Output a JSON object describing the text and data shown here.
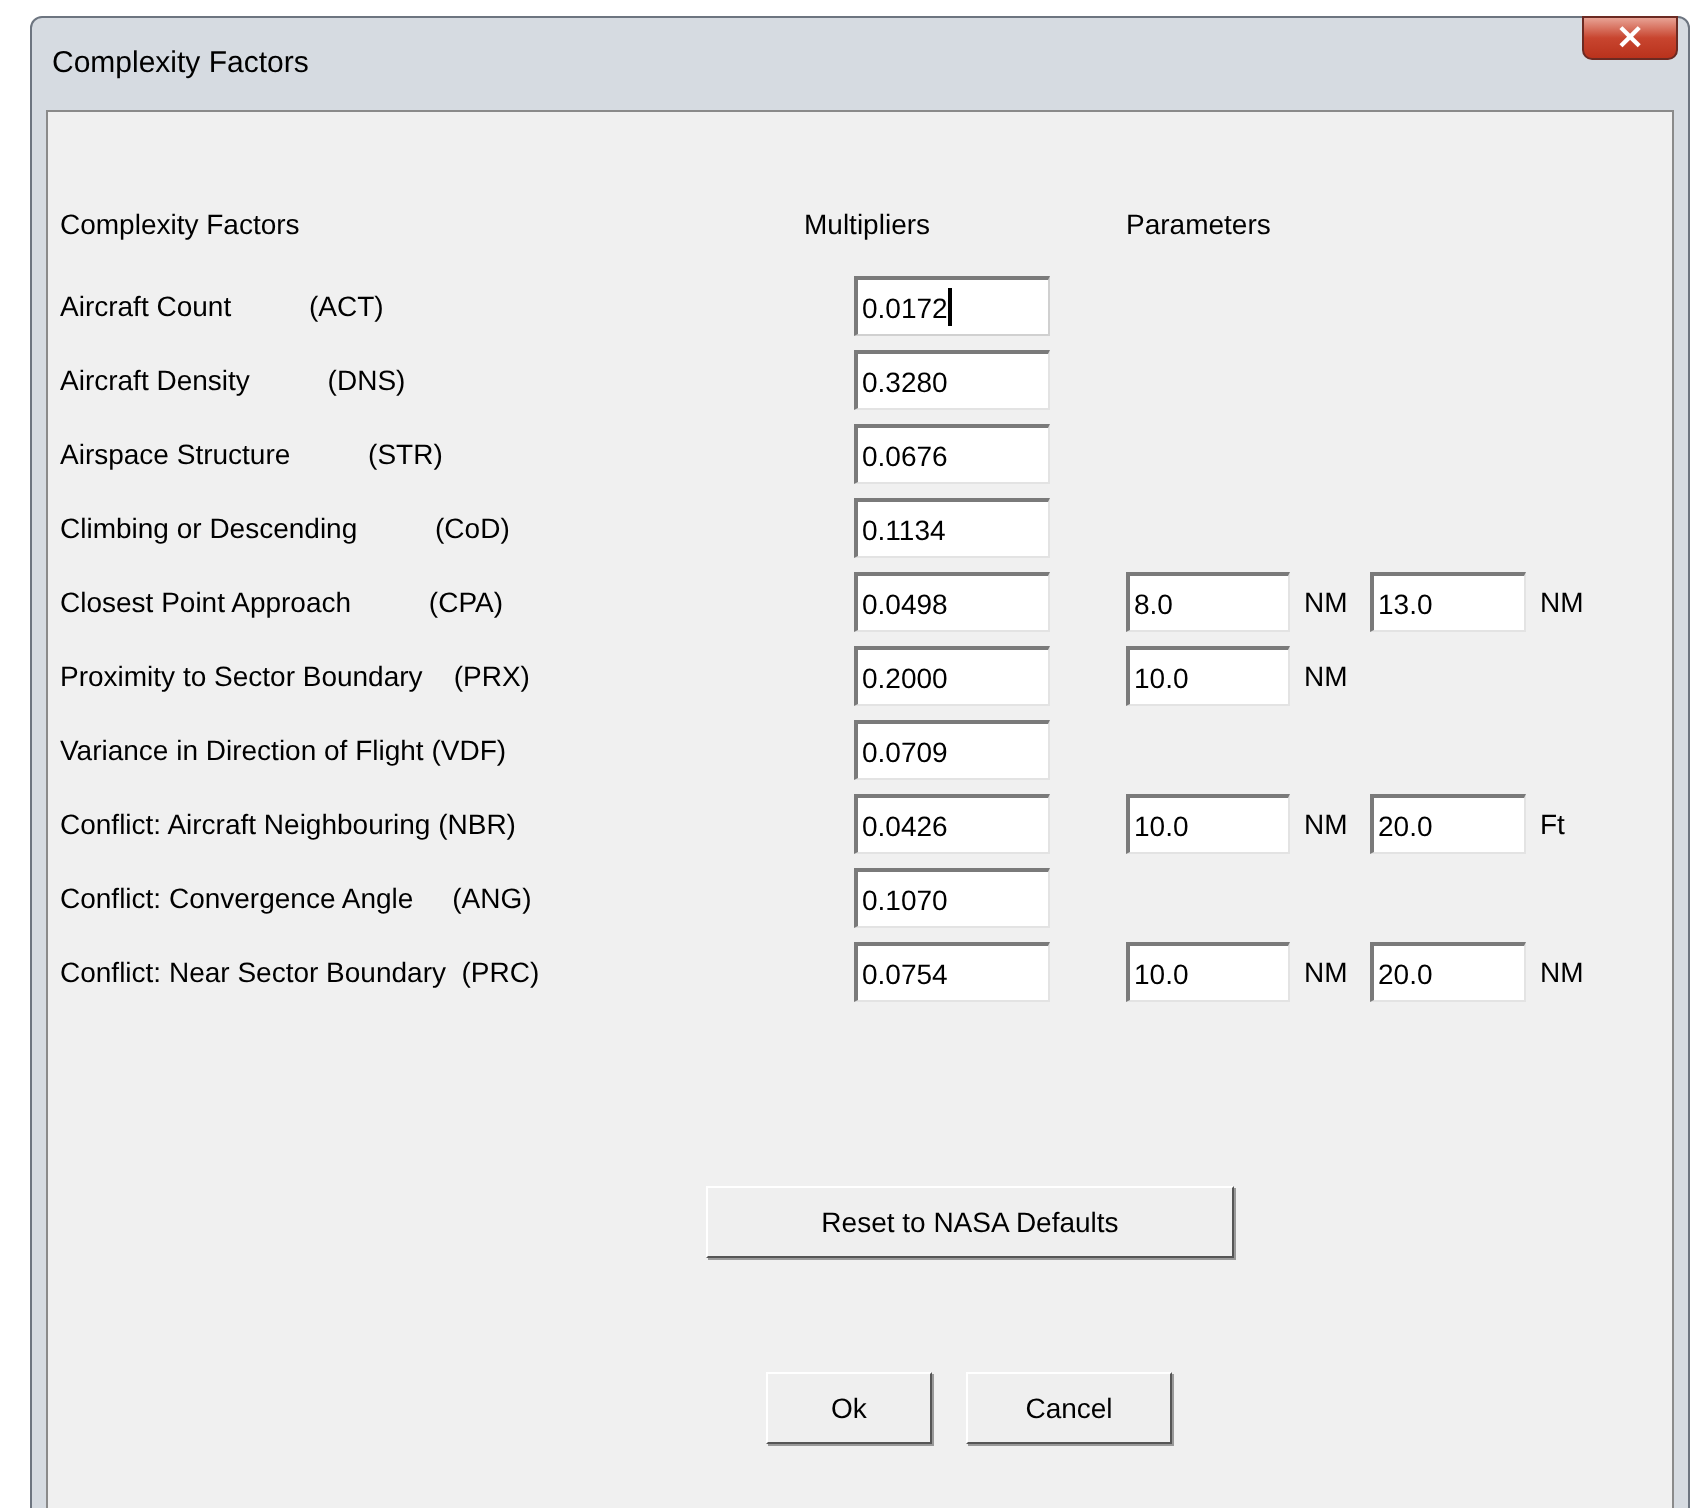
{
  "window": {
    "title": "Complexity Factors",
    "close": "×"
  },
  "headers": {
    "factors": "Complexity Factors",
    "multipliers": "Multipliers",
    "parameters": "Parameters"
  },
  "rows": [
    {
      "label": "Aircraft Count          (ACT)",
      "multiplier": "0.0172",
      "focused": true,
      "params": []
    },
    {
      "label": "Aircraft Density          (DNS)",
      "multiplier": "0.3280",
      "focused": false,
      "params": []
    },
    {
      "label": "Airspace Structure          (STR)",
      "multiplier": "0.0676",
      "focused": false,
      "params": []
    },
    {
      "label": "Climbing or Descending          (CoD)",
      "multiplier": "0.1134",
      "focused": false,
      "params": []
    },
    {
      "label": "Closest Point Approach          (CPA)",
      "multiplier": "0.0498",
      "focused": false,
      "params": [
        {
          "value": "8.0",
          "unit": "NM"
        },
        {
          "value": "13.0",
          "unit": "NM"
        }
      ]
    },
    {
      "label": "Proximity to Sector Boundary    (PRX)",
      "multiplier": "0.2000",
      "focused": false,
      "params": [
        {
          "value": "10.0",
          "unit": "NM"
        }
      ]
    },
    {
      "label": "Variance in Direction of Flight (VDF)",
      "multiplier": "0.0709",
      "focused": false,
      "params": []
    },
    {
      "label": "Conflict: Aircraft Neighbouring (NBR)",
      "multiplier": "0.0426",
      "focused": false,
      "params": [
        {
          "value": "10.0",
          "unit": "NM"
        },
        {
          "value": "20.0",
          "unit": "Ft"
        }
      ]
    },
    {
      "label": "Conflict: Convergence Angle     (ANG)",
      "multiplier": "0.1070",
      "focused": false,
      "params": []
    },
    {
      "label": "Conflict: Near Sector Boundary  (PRC)",
      "multiplier": "0.0754",
      "focused": false,
      "params": [
        {
          "value": "10.0",
          "unit": "NM"
        },
        {
          "value": "20.0",
          "unit": "NM"
        }
      ]
    }
  ],
  "reset_button": "Reset to NASA Defaults",
  "buttons": [
    "Ok",
    "Cancel"
  ]
}
